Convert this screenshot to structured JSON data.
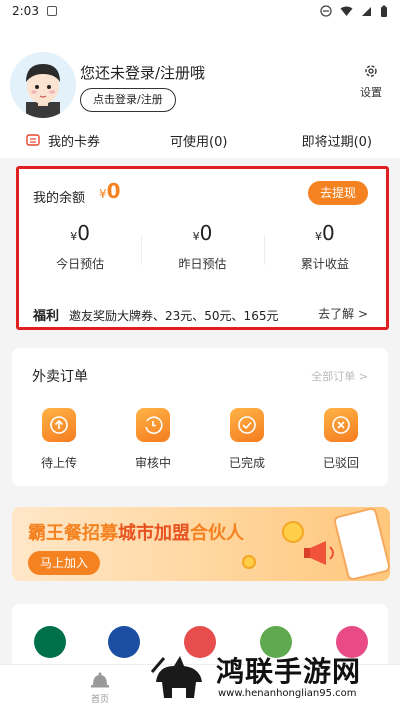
{
  "status_bar": {
    "time": "2:03",
    "notification_icon": "notification-icon",
    "icons": [
      "dnd-icon",
      "wifi-icon",
      "signal-icon",
      "battery-icon"
    ]
  },
  "profile": {
    "title": "您还未登录/注册哦",
    "login_button": "点击登录/注册",
    "settings_label": "设置",
    "settings_icon": "gear-icon"
  },
  "coupons": {
    "mine": "我的卡券",
    "usable": "可使用(0)",
    "expiring": "即将过期(0)"
  },
  "balance": {
    "label": "我的余额",
    "currency": "¥",
    "value": "0",
    "withdraw_button": "去提现",
    "stats": [
      {
        "currency": "¥",
        "value": "0",
        "label": "今日预估"
      },
      {
        "currency": "¥",
        "value": "0",
        "label": "昨日预估"
      },
      {
        "currency": "¥",
        "value": "0",
        "label": "累计收益"
      }
    ],
    "welfare_tag": "福利",
    "welfare_text": "邀友奖励大牌券、23元、50元、165元",
    "learn_more": "去了解 >",
    "highlight_border_color": "#e02020",
    "accent_color": "#f58220"
  },
  "orders": {
    "title": "外卖订单",
    "all_link": "全部订单 >",
    "items": [
      {
        "label": "待上传",
        "icon": "upload-icon"
      },
      {
        "label": "审核中",
        "icon": "review-clock-icon"
      },
      {
        "label": "已完成",
        "icon": "check-icon"
      },
      {
        "label": "已驳回",
        "icon": "reject-icon"
      }
    ]
  },
  "banner": {
    "headline_prefix": "霸王餐招募",
    "headline_highlight": "城市加盟",
    "headline_suffix": "合伙人",
    "join_button": "马上加入"
  },
  "brands": [
    {
      "icon": "starbucks-logo-icon",
      "color": "#00704a"
    },
    {
      "icon": "brand-logo-icon",
      "color": "#1c4fa3"
    },
    {
      "icon": "cotti-logo-icon",
      "color": "#e84d4d"
    },
    {
      "icon": "chaxue-logo-icon",
      "color": "#5fa94f"
    },
    {
      "icon": "pink-brand-logo-icon",
      "color": "#e94b86"
    }
  ],
  "tabbar": {
    "home_label": "首页",
    "home_icon": "home-bell-icon"
  },
  "watermark": {
    "text": "鸿联手游网",
    "url": "www.henanhonglian95.com"
  }
}
